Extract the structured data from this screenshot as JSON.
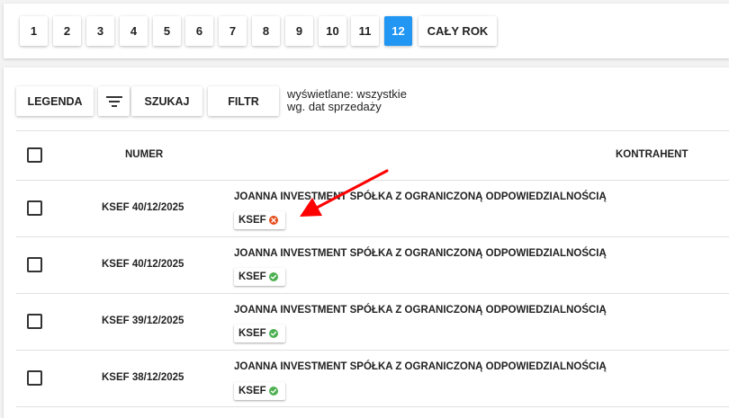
{
  "months": {
    "items": [
      "1",
      "2",
      "3",
      "4",
      "5",
      "6",
      "7",
      "8",
      "9",
      "10",
      "11",
      "12"
    ],
    "active": "12",
    "active_color": "#2196f3",
    "full_year_label": "CAŁY ROK"
  },
  "toolbar": {
    "legend_label": "LEGENDA",
    "filter_icon": "filter-list-icon",
    "search_label": "SZUKAJ",
    "filter_label": "FILTR",
    "info_line1": "wyświetlane: wszystkie",
    "info_line2": "wg. dat sprzedaży"
  },
  "table": {
    "columns": {
      "numer": "NUMER",
      "kontrahent": "KONTRAHENT"
    },
    "rows": [
      {
        "numer": "KSEF 40/12/2025",
        "company": "JOANNA INVESTMENT SPÓŁKA Z OGRANICZONĄ ODPOWIEDZIALNOŚCIĄ",
        "badge": "KSEF",
        "status": "error",
        "status_color": "#e64a19"
      },
      {
        "numer": "KSEF 40/12/2025",
        "company": "JOANNA INVESTMENT SPÓŁKA Z OGRANICZONĄ ODPOWIEDZIALNOŚCIĄ",
        "badge": "KSEF",
        "status": "ok",
        "status_color": "#4caf50"
      },
      {
        "numer": "KSEF 39/12/2025",
        "company": "JOANNA INVESTMENT SPÓŁKA Z OGRANICZONĄ ODPOWIEDZIALNOŚCIĄ",
        "badge": "KSEF",
        "status": "ok",
        "status_color": "#4caf50"
      },
      {
        "numer": "KSEF 38/12/2025",
        "company": "JOANNA INVESTMENT SPÓŁKA Z OGRANICZONĄ ODPOWIEDZIALNOŚCIĄ",
        "badge": "KSEF",
        "status": "ok",
        "status_color": "#4caf50"
      }
    ]
  },
  "annotation": {
    "arrow_color": "#ff0000"
  }
}
